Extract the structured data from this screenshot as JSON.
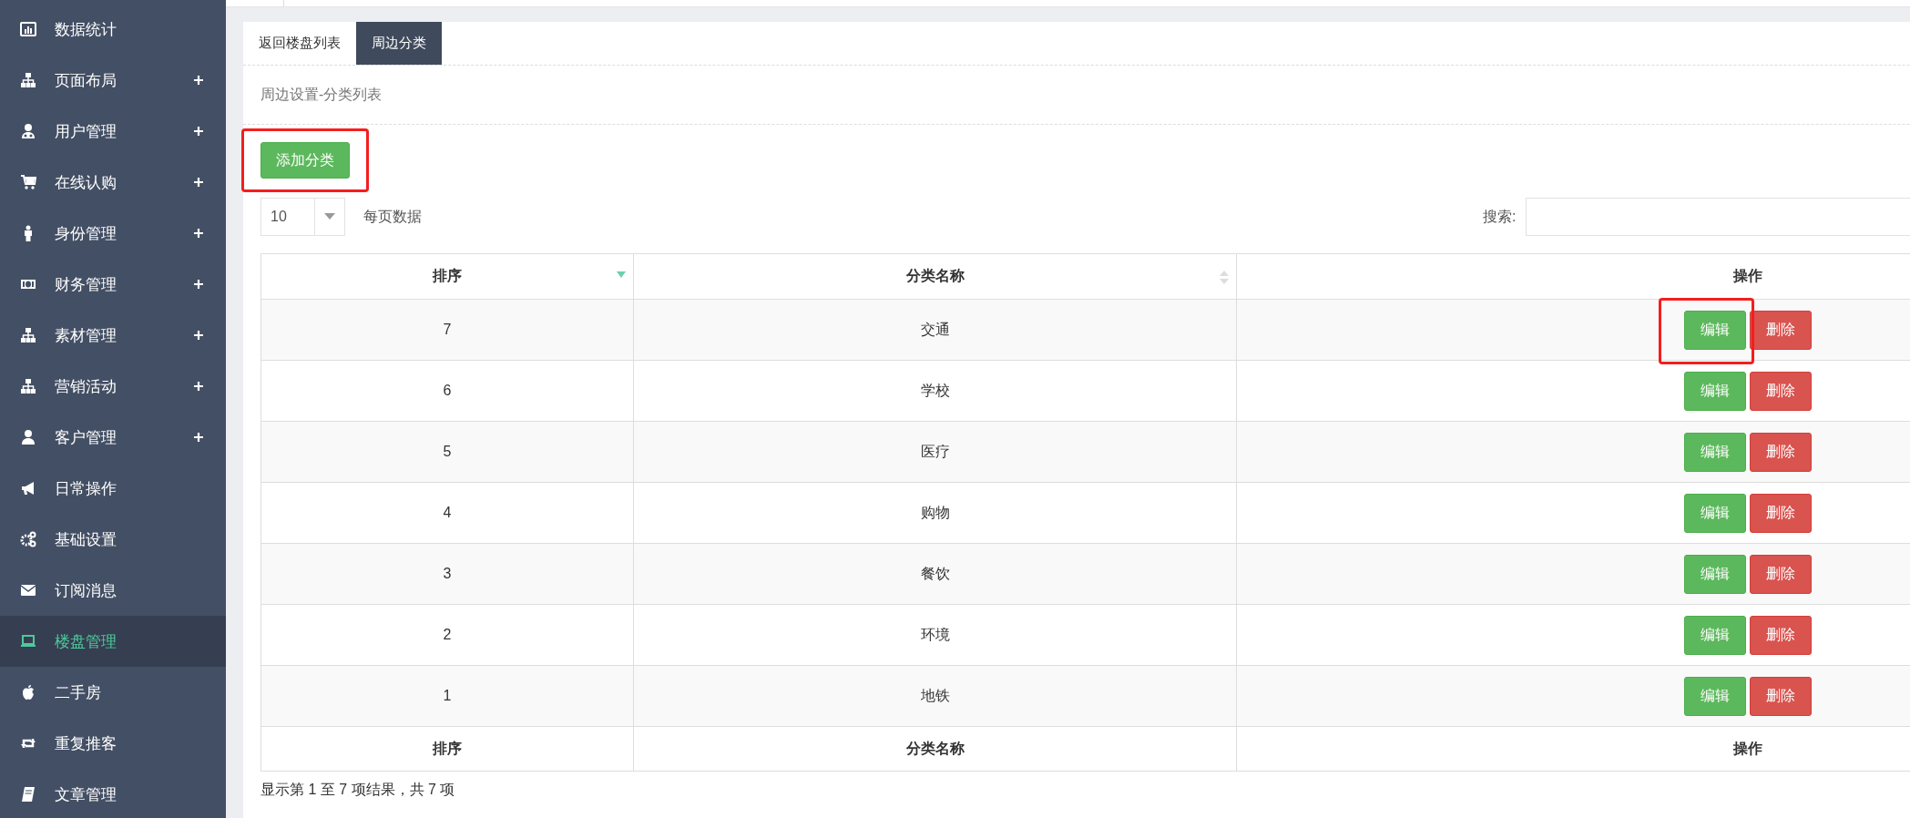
{
  "sidebar": {
    "items": [
      {
        "label": "数据统计",
        "expandable": false,
        "selected": false
      },
      {
        "label": "页面布局",
        "expandable": true,
        "selected": false
      },
      {
        "label": "用户管理",
        "expandable": true,
        "selected": false
      },
      {
        "label": "在线认购",
        "expandable": true,
        "selected": false
      },
      {
        "label": "身份管理",
        "expandable": true,
        "selected": false
      },
      {
        "label": "财务管理",
        "expandable": true,
        "selected": false
      },
      {
        "label": "素材管理",
        "expandable": true,
        "selected": false
      },
      {
        "label": "营销活动",
        "expandable": true,
        "selected": false
      },
      {
        "label": "客户管理",
        "expandable": true,
        "selected": false
      },
      {
        "label": "日常操作",
        "expandable": false,
        "selected": false
      },
      {
        "label": "基础设置",
        "expandable": false,
        "selected": false
      },
      {
        "label": "订阅消息",
        "expandable": false,
        "selected": false
      },
      {
        "label": "楼盘管理",
        "expandable": false,
        "selected": true
      },
      {
        "label": "二手房",
        "expandable": false,
        "selected": false
      },
      {
        "label": "重复推客",
        "expandable": false,
        "selected": false
      },
      {
        "label": "文章管理",
        "expandable": false,
        "selected": false
      }
    ]
  },
  "tabs": [
    {
      "label": "返回楼盘列表",
      "selected": false
    },
    {
      "label": "周边分类",
      "selected": true
    }
  ],
  "subtitle": "周边设置-分类列表",
  "add_button": {
    "label": "添加分类",
    "highlighted": true
  },
  "page_length": {
    "value": "10",
    "label": "每页数据"
  },
  "search": {
    "label": "搜索:"
  },
  "table": {
    "columns": [
      {
        "label": "排序",
        "sorted": true
      },
      {
        "label": "分类名称",
        "sortable": true,
        "sorted": false
      },
      {
        "label": "操作",
        "sortable": false
      }
    ],
    "rows": [
      {
        "order": "7",
        "name": "交通",
        "edit": "编辑",
        "delete": "删除",
        "highlighted": true
      },
      {
        "order": "6",
        "name": "学校",
        "edit": "编辑",
        "delete": "删除",
        "highlighted": false
      },
      {
        "order": "5",
        "name": "医疗",
        "edit": "编辑",
        "delete": "删除",
        "highlighted": false
      },
      {
        "order": "4",
        "name": "购物",
        "edit": "编辑",
        "delete": "删除",
        "highlighted": false
      },
      {
        "order": "3",
        "name": "餐饮",
        "edit": "编辑",
        "delete": "删除",
        "highlighted": false
      },
      {
        "order": "2",
        "name": "环境",
        "edit": "编辑",
        "delete": "删除",
        "highlighted": false
      },
      {
        "order": "1",
        "name": "地铁",
        "edit": "编辑",
        "delete": "删除",
        "highlighted": false
      }
    ],
    "footer_columns": [
      "排序",
      "分类名称",
      "操作"
    ]
  },
  "info": "显示第 1 至 7 项结果，共 7 项"
}
